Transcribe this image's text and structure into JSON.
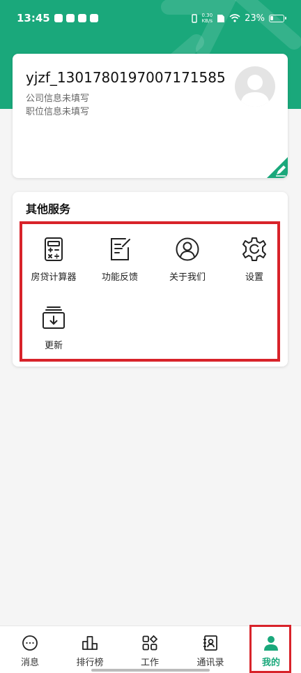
{
  "status_bar": {
    "time": "13:45",
    "net_speed_value": "0.30",
    "net_speed_unit": "KB/s",
    "battery": "23%"
  },
  "profile": {
    "username": "yjzf_1301780197007171585",
    "company": "公司信息未填写",
    "position": "职位信息未填写"
  },
  "services": {
    "title": "其他服务",
    "items": [
      {
        "label": "房贷计算器",
        "icon": "calculator-icon"
      },
      {
        "label": "功能反馈",
        "icon": "feedback-icon"
      },
      {
        "label": "关于我们",
        "icon": "user-circle-icon"
      },
      {
        "label": "设置",
        "icon": "gear-icon"
      },
      {
        "label": "更新",
        "icon": "update-icon"
      }
    ]
  },
  "tabs": [
    {
      "label": "消息",
      "icon": "chat-icon"
    },
    {
      "label": "排行榜",
      "icon": "ranking-icon"
    },
    {
      "label": "工作",
      "icon": "grid-icon"
    },
    {
      "label": "通讯录",
      "icon": "contacts-icon"
    },
    {
      "label": "我的",
      "icon": "person-icon",
      "active": true
    }
  ],
  "colors": {
    "brand": "#1aa87b",
    "highlight": "#d8232a"
  }
}
